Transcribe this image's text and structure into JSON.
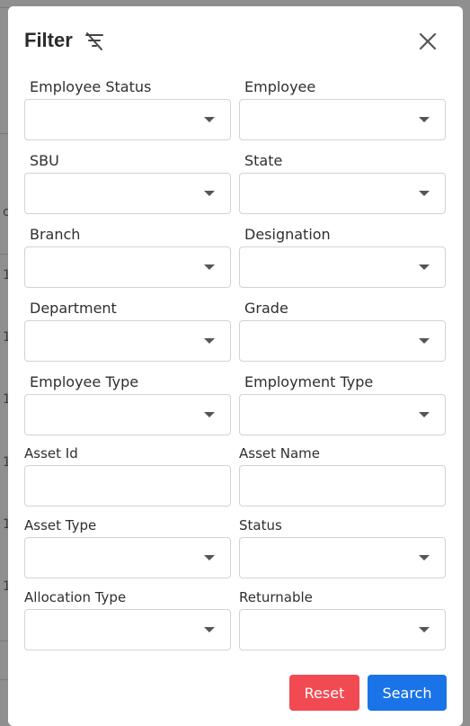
{
  "modal": {
    "title": "Filter",
    "icons": {
      "title_icon": "filter-off-icon",
      "close_icon": "close-icon"
    }
  },
  "fields": {
    "employee_status": {
      "label": "Employee Status",
      "value": ""
    },
    "employee": {
      "label": "Employee",
      "value": ""
    },
    "sbu": {
      "label": "SBU",
      "value": ""
    },
    "state": {
      "label": "State",
      "value": ""
    },
    "branch": {
      "label": "Branch",
      "value": ""
    },
    "designation": {
      "label": "Designation",
      "value": ""
    },
    "department": {
      "label": "Department",
      "value": ""
    },
    "grade": {
      "label": "Grade",
      "value": ""
    },
    "employee_type": {
      "label": "Employee Type",
      "value": ""
    },
    "employment_type": {
      "label": "Employment Type",
      "value": ""
    },
    "asset_id": {
      "label": "Asset Id",
      "value": ""
    },
    "asset_name": {
      "label": "Asset Name",
      "value": ""
    },
    "asset_type": {
      "label": "Asset Type",
      "value": ""
    },
    "status": {
      "label": "Status",
      "value": ""
    },
    "allocation_type": {
      "label": "Allocation Type",
      "value": ""
    },
    "returnable": {
      "label": "Returnable",
      "value": ""
    }
  },
  "buttons": {
    "reset": "Reset",
    "search": "Search"
  },
  "background": {
    "chars": [
      "c",
      "1",
      "1",
      "1",
      "1",
      "1",
      "1"
    ]
  },
  "colors": {
    "reset": "#f24a52",
    "search": "#1a73e8",
    "overlay": "#8f8f8f"
  }
}
